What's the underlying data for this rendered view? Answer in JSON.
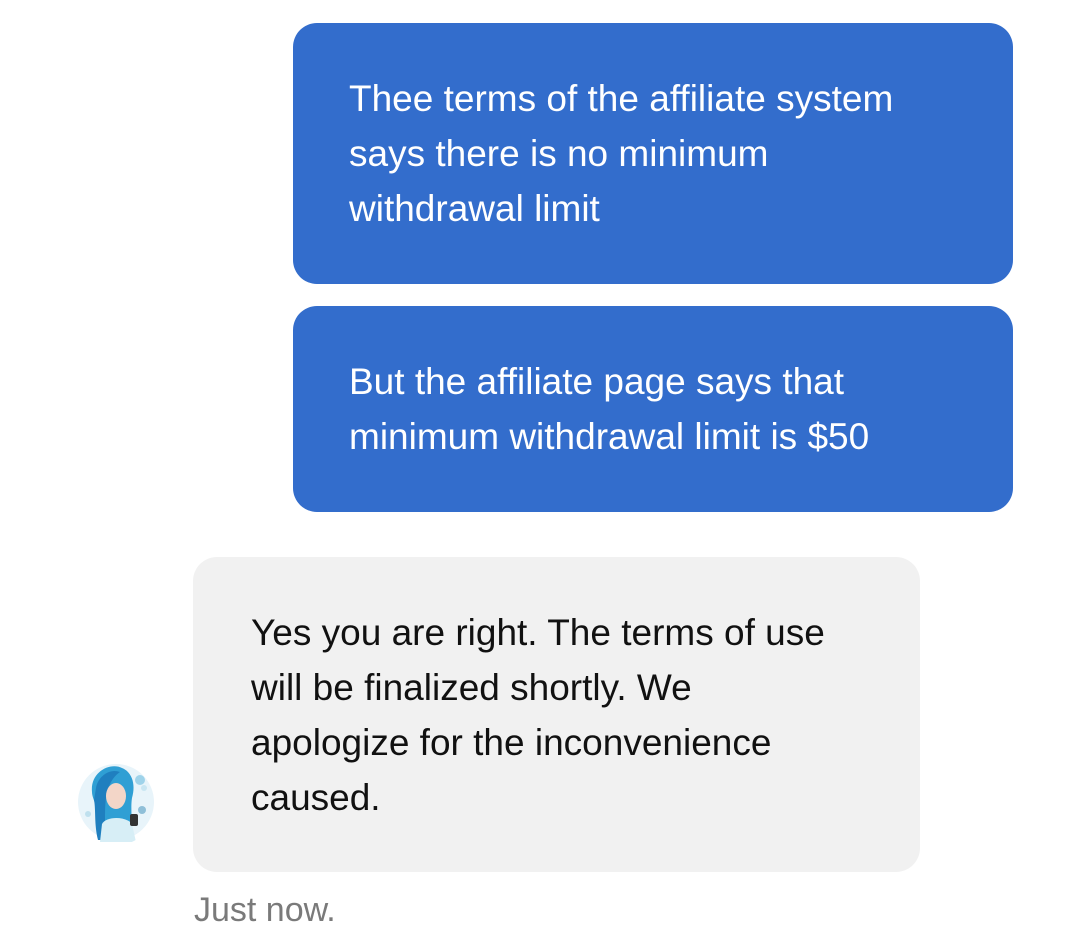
{
  "messages": [
    {
      "direction": "outgoing",
      "lines": [
        "Thee terms of the affiliate system",
        "says there is no minimum",
        "withdrawal limit"
      ]
    },
    {
      "direction": "outgoing",
      "lines": [
        "But the affiliate page says that",
        "minimum withdrawal limit is $50"
      ]
    },
    {
      "direction": "incoming",
      "lines": [
        "Yes you are right. The terms of use",
        "will be finalized shortly. We",
        "apologize for the inconvenience",
        "caused."
      ]
    }
  ],
  "agent": {
    "avatar_icon": "agent-avatar"
  },
  "timestamp": "Just now.",
  "colors": {
    "outgoing_bubble": "#336dcc",
    "incoming_bubble": "#f1f1f1",
    "outgoing_text": "#ffffff",
    "incoming_text": "#111111",
    "timestamp_text": "#7a7a7a"
  }
}
